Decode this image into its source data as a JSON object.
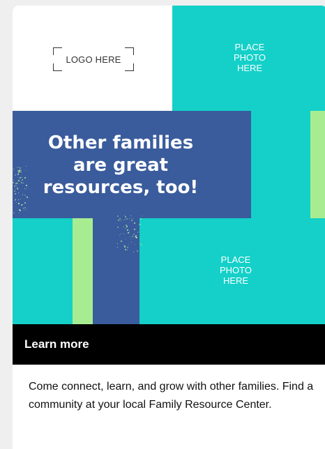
{
  "hero": {
    "logo_placeholder": "LOGO HERE",
    "photo_top_label": "PLACE\nPHOTO\nHERE",
    "photo_bottom_label": "PLACE\nPHOTO\nHERE",
    "headline": "Other families\nare great\nresources, too!"
  },
  "cta": {
    "label": "Learn more"
  },
  "description": "Come connect, learn, and grow with other families. Find a community at your local Family Resource Center.",
  "colors": {
    "teal": "#14d0c8",
    "blue": "#3a5c9c",
    "green": "#a8ec92",
    "bar": "#000000"
  }
}
